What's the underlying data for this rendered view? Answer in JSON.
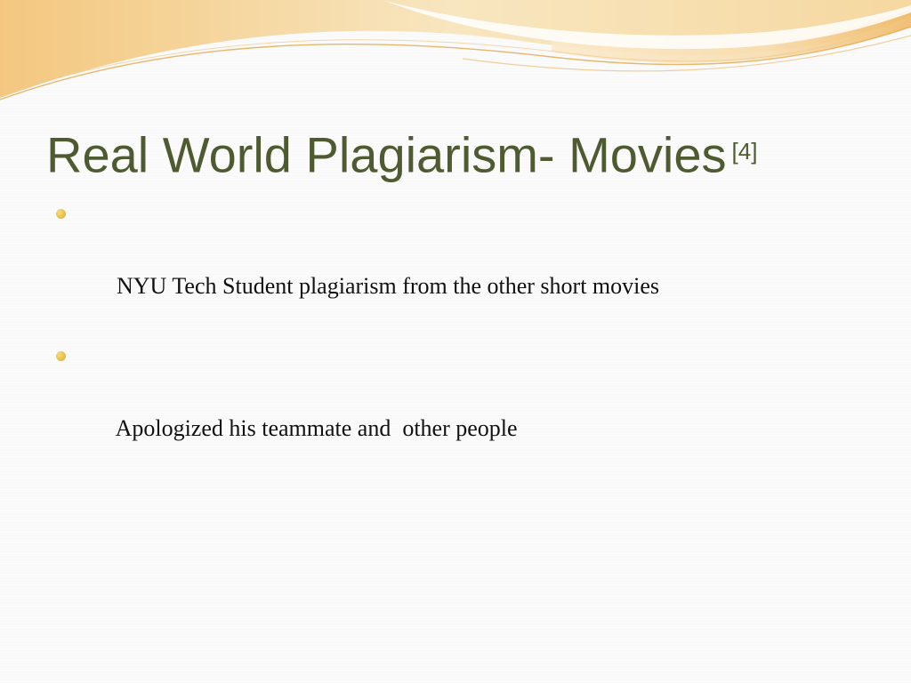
{
  "slide": {
    "title": "Real World Plagiarism- Movies",
    "title_reference": "[4]",
    "bullets": [
      {
        "text": "NYU Tech Student plagiarism from the other short movies"
      },
      {
        "text": "Apologized his teammate and  other people"
      }
    ]
  },
  "colors": {
    "title": "#4e5b31",
    "bullet_dot": "#e8b93a",
    "body_text": "#111111",
    "wave_light": "#f7e3b4",
    "wave_accent": "#efb860",
    "background": "#fbfbfb"
  },
  "icons": {
    "bullet": "round-bullet-icon",
    "decoration": "header-wave-decoration"
  }
}
